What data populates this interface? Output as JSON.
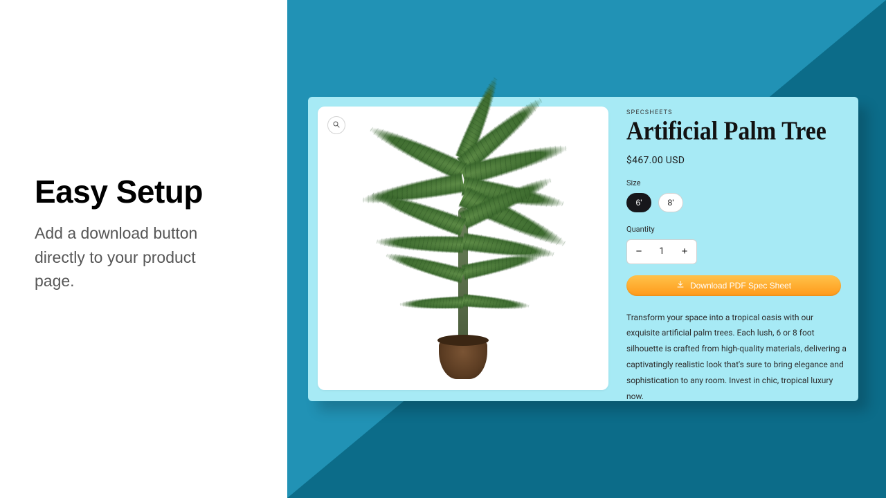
{
  "marketing": {
    "headline": "Easy Setup",
    "subtext": "Add a download button directly to your product page."
  },
  "product": {
    "overline": "SPECSHEETS",
    "title": "Artificial Palm Tree",
    "price": "$467.00 USD",
    "size_label": "Size",
    "sizes": {
      "opt1": "6'",
      "opt2": "8'"
    },
    "quantity_label": "Quantity",
    "quantity_value": "1",
    "download_label": "Download PDF Spec Sheet",
    "description": "Transform your space into a tropical oasis with our exquisite artificial palm trees. Each lush, 6 or 8 foot silhouette is crafted from high-quality materials, delivering a captivatingly realistic look that's sure to bring elegance and sophistication to any room. Invest in chic, tropical luxury now."
  },
  "icons": {
    "zoom": "zoom",
    "download": "download",
    "minus": "−",
    "plus": "+"
  }
}
